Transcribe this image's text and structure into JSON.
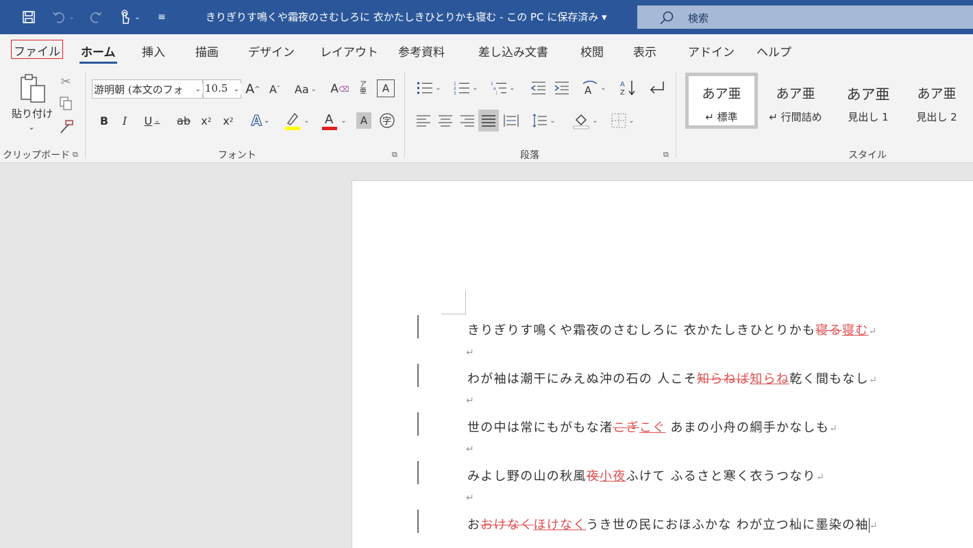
{
  "titlebar": {
    "title": "きりぎりす鳴くや霜夜のさむしろに 衣かたしきひとりかも寝む - この PC に保存済み ▾",
    "search_placeholder": "検索",
    "icons": [
      "save-icon",
      "undo-icon",
      "redo-icon",
      "touch-mode-icon",
      "customize-qat-icon"
    ]
  },
  "menu": {
    "tabs": [
      "ファイル",
      "ホーム",
      "挿入",
      "描画",
      "デザイン",
      "レイアウト",
      "参考資料",
      "差し込み文書",
      "校閲",
      "表示",
      "アドイン",
      "ヘルプ"
    ],
    "active": "ホーム",
    "highlighted": "ファイル"
  },
  "ribbon": {
    "clipboard": {
      "label": "クリップボード",
      "paste_label": "貼り付け"
    },
    "font": {
      "label": "フォント",
      "font_name": "游明朝 (本文のフォ",
      "font_size": "10.5"
    },
    "paragraph": {
      "label": "段落"
    },
    "styles": {
      "label": "スタイル",
      "items": [
        {
          "sample": "あア亜",
          "name": "↵ 標準"
        },
        {
          "sample": "あア亜",
          "name": "↵ 行間詰め"
        },
        {
          "sample": "あア亜",
          "name": "見出し 1"
        },
        {
          "sample": "あア亜",
          "name": "見出し 2"
        }
      ]
    },
    "colors": {
      "highlight": "#ffff00",
      "font_color": "#e02020",
      "accent": "#2b579a"
    }
  },
  "document": {
    "paragraph_mark": "↵",
    "lines": [
      {
        "a": "きりぎりす鳴くや霜夜のさむしろに 衣かたしきひとりかも",
        "del": "寝る",
        "ins": "寝む",
        "b": ""
      },
      {
        "a": "わが袖は潮干にみえぬ沖の石の 人こそ",
        "del": "知らねば",
        "ins": "知らね",
        "b": "乾く間もなし"
      },
      {
        "a": "世の中は常にもがもな渚",
        "del": "こぎ",
        "ins": "こぐ",
        "b": " あまの小舟の綱手かなしも"
      },
      {
        "a": "みよし野の山の秋風",
        "del": "夜",
        "ins": "小夜",
        "b": "ふけて ふるさと寒く衣うつなり"
      },
      {
        "a": "お",
        "del": "おけなく",
        "ins": "ほけなく",
        "b": "うき世の民におほふかな わが立つ杣に墨染の袖"
      }
    ]
  }
}
